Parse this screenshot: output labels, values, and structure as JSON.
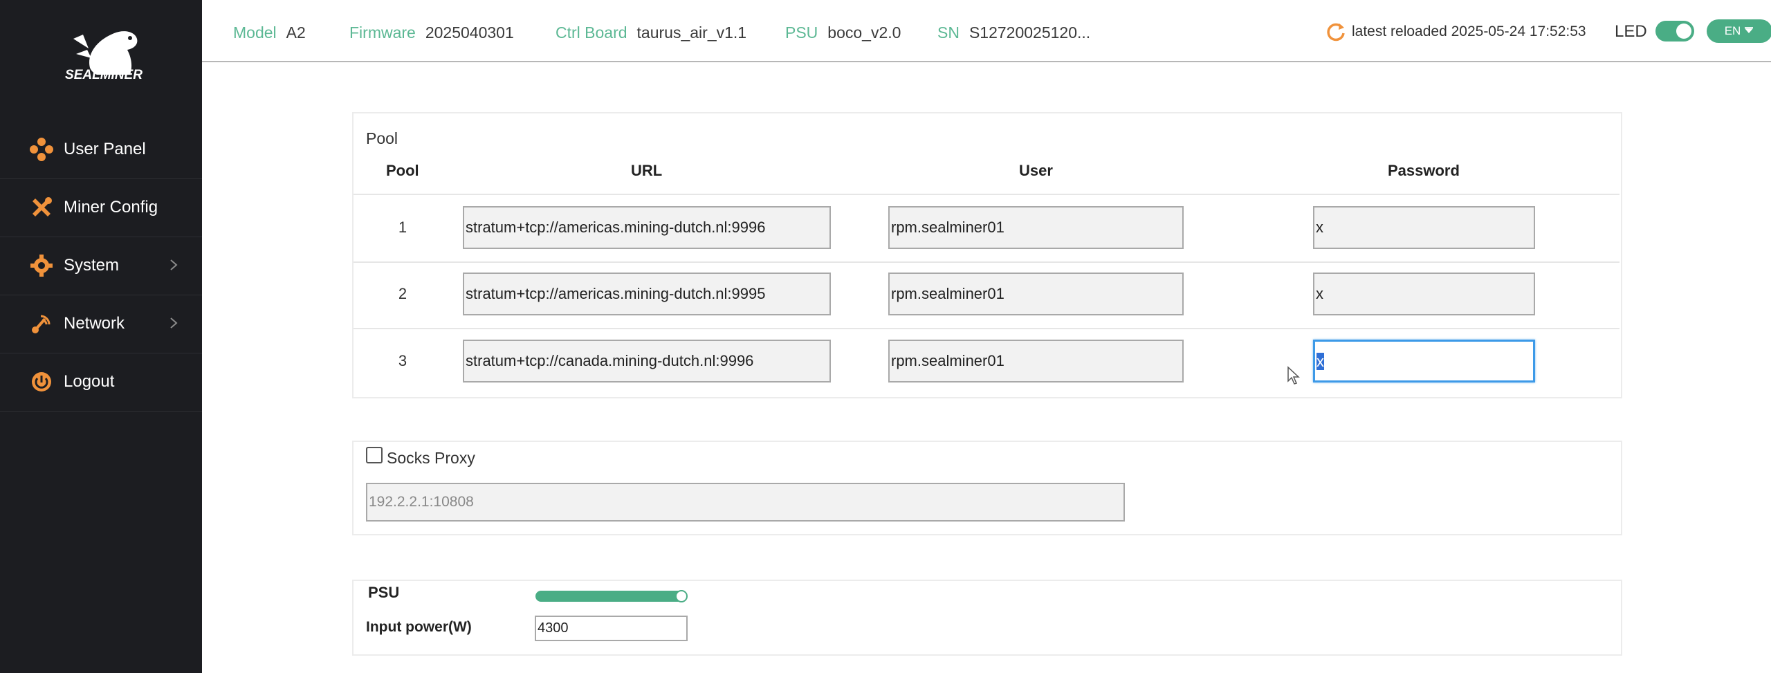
{
  "brand": {
    "logo_text": "SEALMINER"
  },
  "sidebar": {
    "items": [
      {
        "label": "User Panel",
        "icon": "diamond-dots-icon",
        "has_chevron": false
      },
      {
        "label": "Miner Config",
        "icon": "tools-icon",
        "has_chevron": false
      },
      {
        "label": "System",
        "icon": "gear-icon",
        "has_chevron": true
      },
      {
        "label": "Network",
        "icon": "network-icon",
        "has_chevron": true
      },
      {
        "label": "Logout",
        "icon": "power-icon",
        "has_chevron": false
      }
    ]
  },
  "header": {
    "model_label": "Model",
    "model_value": "A2",
    "firmware_label": "Firmware",
    "firmware_value": "2025040301",
    "ctrl_label": "Ctrl Board",
    "ctrl_value": "taurus_air_v1.1",
    "psu_label": "PSU",
    "psu_value": "boco_v2.0",
    "sn_label": "SN",
    "sn_value": "S12720025120...",
    "reload_text": "latest reloaded 2025-05-24 17:52:53",
    "led_label": "LED",
    "led_on": true,
    "lang": "EN"
  },
  "pool": {
    "title": "Pool",
    "headers": {
      "pool": "Pool",
      "url": "URL",
      "user": "User",
      "password": "Password"
    },
    "rows": [
      {
        "num": "1",
        "url": "stratum+tcp://americas.mining-dutch.nl:9996",
        "user": "rpm.sealminer01",
        "password": "x"
      },
      {
        "num": "2",
        "url": "stratum+tcp://americas.mining-dutch.nl:9995",
        "user": "rpm.sealminer01",
        "password": "x"
      },
      {
        "num": "3",
        "url": "stratum+tcp://canada.mining-dutch.nl:9996",
        "user": "rpm.sealminer01",
        "password": "x"
      }
    ]
  },
  "socks": {
    "label": "Socks Proxy",
    "checked": false,
    "placeholder": "192.2.2.1:10808"
  },
  "psu": {
    "title": "PSU",
    "slider_level": 1.0,
    "input_label": "Input power(W)",
    "input_value": "4300"
  },
  "colors": {
    "accent": "#4aad85",
    "label_green": "#5cb894",
    "sidebar_bg": "#1c1d21",
    "icon_orange": "#f0923b",
    "focus_blue": "#3d9ae8"
  }
}
